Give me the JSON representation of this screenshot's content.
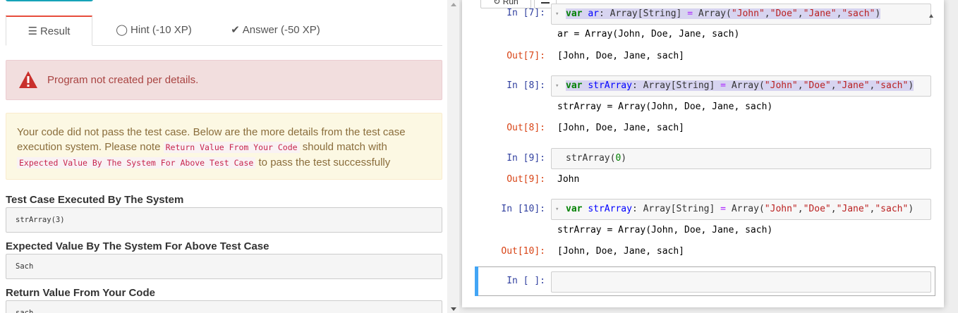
{
  "left": {
    "tabs": [
      {
        "label": "Result",
        "icon": "list-icon",
        "active": true
      },
      {
        "label": "Hint (-10 XP)",
        "icon": "lightbulb-icon"
      },
      {
        "label": "Answer (-50 XP)",
        "icon": "checkmark-icon"
      }
    ],
    "alert": "Program not created per details.",
    "info": {
      "text1": "Your code did not pass the test case. Below are the more details from the test case execution system. Please note ",
      "code1": "Return Value From Your Code",
      "text2": " should match with ",
      "code2": "Expected Value By The System For Above Test Case",
      "text3": " to pass the test successfully"
    },
    "test_case_label": "Test Case Executed By The System",
    "test_case_value": "strArray(3)",
    "expected_label": "Expected Value By The System For Above Test Case",
    "expected_value": "Sach",
    "return_label": "Return Value From Your Code",
    "return_value": "sach"
  },
  "notebook": {
    "toolbar": {
      "run_label": "Run",
      "run_icon": "run-icon",
      "menu_icon": "list-icon"
    },
    "cells": [
      {
        "in_prompt": "In [7]:",
        "code": {
          "kw": "var",
          "name": "ar",
          "type": ": Array[String] ",
          "eq": "=",
          "call": " Array(",
          "s1": "\"John\"",
          "s2": "\"Doe\"",
          "s3": "\"Jane\"",
          "s4": "\"sach\"",
          "close": ")"
        },
        "result": "ar = Array(John, Doe, Jane, sach)",
        "out_prompt": "Out[7]:",
        "out": "[John, Doe, Jane, sach]"
      },
      {
        "in_prompt": "In [8]:",
        "code": {
          "kw": "var",
          "name": "strArray",
          "type": ": Array[String] ",
          "eq": "=",
          "call": " Array(",
          "s1": "\"John\"",
          "s2": "\"Doe\"",
          "s3": "\"Jane\"",
          "s4": "\"sach\"",
          "close": ")"
        },
        "result": "strArray = Array(John, Doe, Jane, sach)",
        "out_prompt": "Out[8]:",
        "out": "[John, Doe, Jane, sach]"
      },
      {
        "in_prompt": "In [9]:",
        "code_plain": "strArray(",
        "code_num": "0",
        "code_close": ")",
        "out_prompt": "Out[9]:",
        "out": "John"
      },
      {
        "in_prompt": "In [10]:",
        "code": {
          "kw": "var",
          "name": "strArray",
          "type": ": Array[String] ",
          "eq": "=",
          "call": " Array(",
          "s1": "\"John\"",
          "s2": "\"Doe\"",
          "s3": "\"Jane\"",
          "s4": "\"sach\"",
          "close": ")"
        },
        "result": "strArray = Array(John, Doe, Jane, sach)",
        "out_prompt": "Out[10]:",
        "out": "[John, Doe, Jane, sach]"
      },
      {
        "in_prompt": "In [ ]:"
      }
    ]
  },
  "colors": {
    "accent_tab": "#e74c3c",
    "alert_text": "#a94442",
    "info_text": "#8a6d3b",
    "in_prompt": "#303f9f",
    "out_prompt": "#d84315",
    "cell_selected": "#42a5f5"
  }
}
